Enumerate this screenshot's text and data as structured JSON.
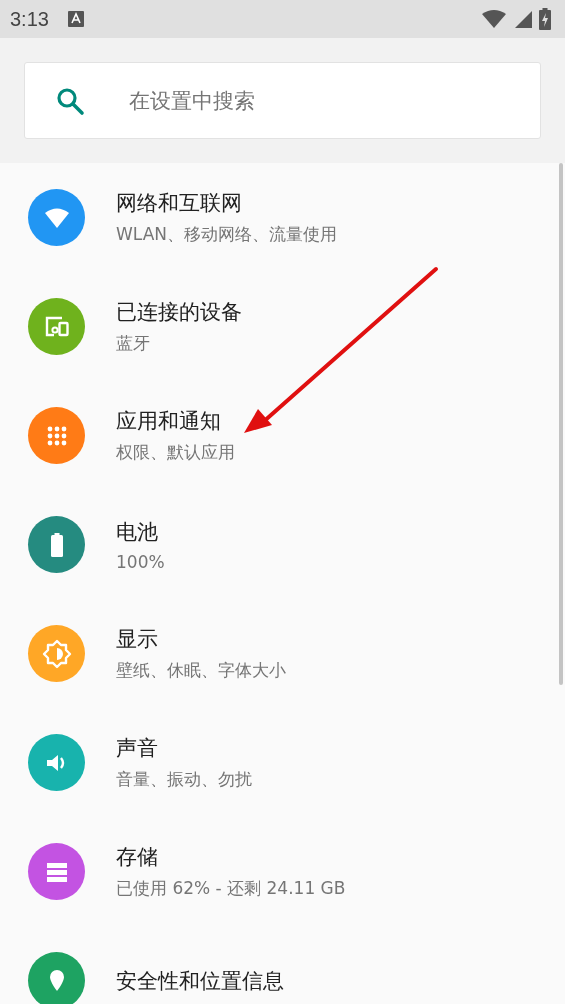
{
  "status_bar": {
    "time": "3:13"
  },
  "search": {
    "placeholder": "在设置中搜索"
  },
  "settings": [
    {
      "kind": "network",
      "color": "#2196f3",
      "title": "网络和互联网",
      "subtitle": "WLAN、移动网络、流量使用"
    },
    {
      "kind": "devices",
      "color": "#6fb21d",
      "title": "已连接的设备",
      "subtitle": "蓝牙"
    },
    {
      "kind": "apps",
      "color": "#ff7b16",
      "title": "应用和通知",
      "subtitle": "权限、默认应用"
    },
    {
      "kind": "battery",
      "color": "#258b80",
      "title": "电池",
      "subtitle": "100%"
    },
    {
      "kind": "display",
      "color": "#ffa726",
      "title": "显示",
      "subtitle": "壁纸、休眠、字体大小"
    },
    {
      "kind": "sound",
      "color": "#18b3ad",
      "title": "声音",
      "subtitle": "音量、振动、勿扰"
    },
    {
      "kind": "storage",
      "color": "#c353e2",
      "title": "存储",
      "subtitle": "已使用 62% - 还剩 24.11 GB"
    },
    {
      "kind": "security",
      "color": "#1ea362",
      "title": "安全性和位置信息"
    }
  ],
  "annotation": {
    "kind": "arrow"
  }
}
